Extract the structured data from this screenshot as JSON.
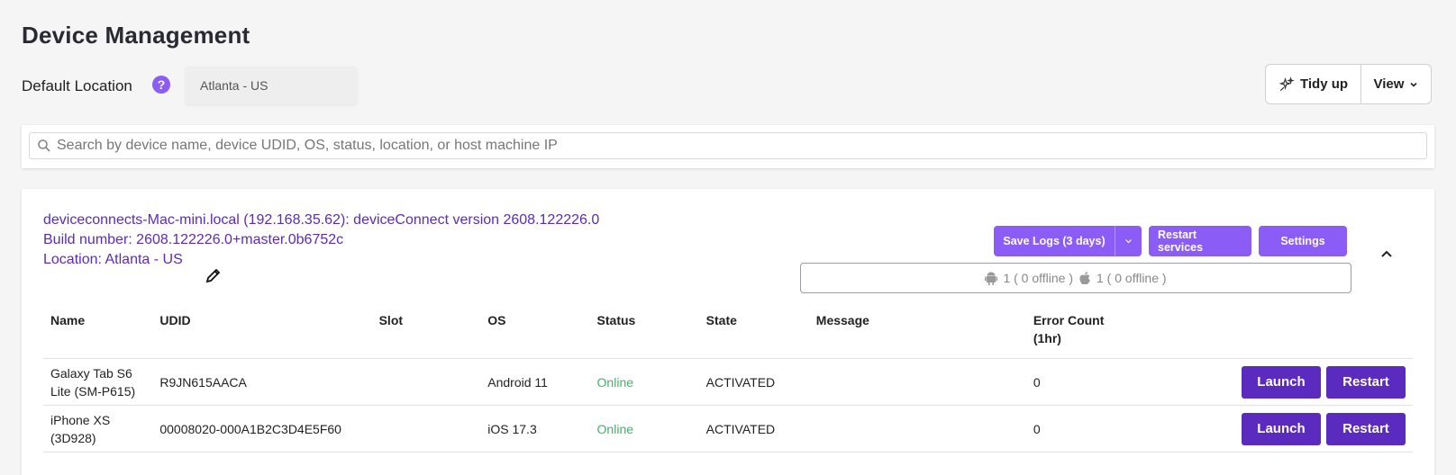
{
  "page": {
    "title": "Device Management",
    "default_location_label": "Default Location",
    "help_symbol": "?",
    "location_value": "Atlanta - US"
  },
  "toolbar": {
    "tidy_label": "Tidy up",
    "view_label": "View"
  },
  "search": {
    "placeholder": "Search by device name, device UDID, OS, status, location, or host machine IP",
    "value": ""
  },
  "host": {
    "title_line": "deviceconnects-Mac-mini.local (192.168.35.62): deviceConnect version 2608.122226.0",
    "build_line": "Build number: 2608.122226.0+master.0b6752c",
    "location_line": "Location: Atlanta - US",
    "buttons": {
      "save_logs": "Save Logs (3 days)",
      "restart_services": "Restart services",
      "settings": "Settings"
    },
    "counts": {
      "android": "1 ( 0 offline )",
      "ios": "1 ( 0 offline )"
    }
  },
  "table": {
    "headers": {
      "name": "Name",
      "udid": "UDID",
      "slot": "Slot",
      "os": "OS",
      "status": "Status",
      "state": "State",
      "message": "Message",
      "error_count_line1": "Error Count",
      "error_count_line2": "(1hr)"
    },
    "rows": [
      {
        "name": "Galaxy Tab S6 Lite (SM-P615)",
        "udid": "R9JN615AACA",
        "slot": "",
        "os": "Android 11",
        "status": "Online",
        "state": "ACTIVATED",
        "message": "",
        "error_count": "0",
        "launch": "Launch",
        "restart": "Restart"
      },
      {
        "name": "iPhone XS (3D928)",
        "udid": "00008020-000A1B2C3D4E5F60",
        "slot": "",
        "os": "iOS 17.3",
        "status": "Online",
        "state": "ACTIVATED",
        "message": "",
        "error_count": "0",
        "launch": "Launch",
        "restart": "Restart"
      }
    ]
  },
  "colors": {
    "accent": "#8b5cf6",
    "accent_dark": "#5b2bbf",
    "online": "#3fb56a"
  }
}
